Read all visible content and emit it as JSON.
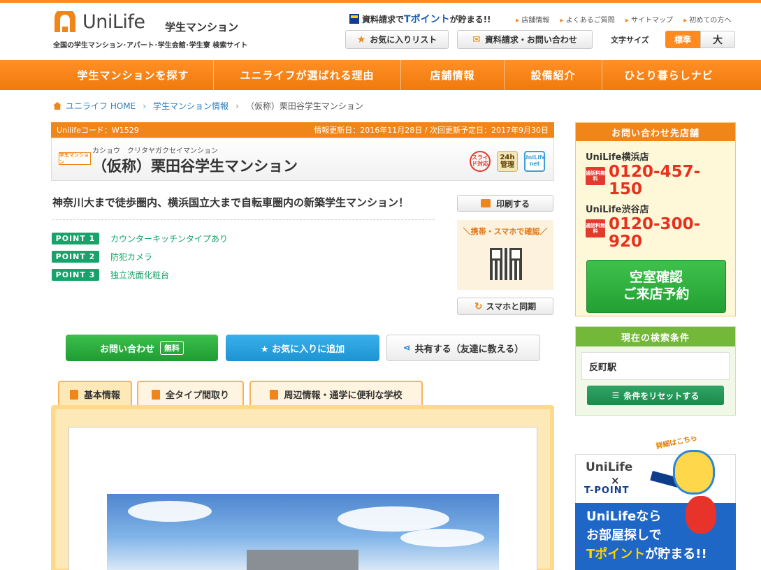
{
  "header": {
    "logo_name": "UniLife",
    "logo_sub": "学生マンション",
    "logo_tag": "全国の学生マンション･アパート･学生会館･学生寮 検索サイト",
    "tpoint_pre": "資料請求で",
    "tpoint_brand": "Tポイント",
    "tpoint_post": "が貯まる!!",
    "top_links": [
      "店舗情報",
      "よくあるご質問",
      "サイトマップ",
      "初めての方へ"
    ],
    "favorites_label": "お気に入りリスト",
    "request_label": "資料請求・お問い合わせ",
    "font_size_label": "文字サイズ",
    "font_std": "標準",
    "font_big": "大"
  },
  "nav": [
    "学生マンションを探す",
    "ユニライフが選ばれる理由",
    "店舗情報",
    "設備紹介",
    "ひとり暮らしナビ"
  ],
  "breadcrumb": {
    "home": "ユニライフ HOME",
    "level2": "学生マンション情報",
    "current": "（仮称）栗田谷学生マンション"
  },
  "property": {
    "code": "Unilifeコード：W1529",
    "updated": "情報更新日：2016年11月28日 / 次回更新予定日：2017年9月30日",
    "type_logo": "学生マンション",
    "kana": "カショウ　クリタヤガクセイマンション",
    "name": "（仮称）栗田谷学生マンション",
    "badges": [
      "スライド対応",
      "24h管理",
      "UniLife net"
    ],
    "catch": "神奈川大まで徒歩圏内、横浜国立大まで自転車圏内の新築学生マンション！",
    "points": [
      {
        "label": "POINT 1",
        "text": "カウンターキッチンタイプあり"
      },
      {
        "label": "POINT 2",
        "text": "防犯カメラ"
      },
      {
        "label": "POINT 3",
        "text": "独立洗面化粧台"
      }
    ],
    "print_label": "印刷する",
    "mobile_label": "＼携帯・スマホで確認／",
    "sync_label": "スマホと同期"
  },
  "actions": {
    "contact": "お問い合わせ",
    "contact_free": "無料",
    "favorite": "★ お気に入りに追加",
    "share": "共有する（友達に教える）"
  },
  "tabs": [
    "基本情報",
    "全タイプ間取り",
    "周辺情報・通学に便利な学校"
  ],
  "sidebar": {
    "contact_title": "お問い合わせ先店舗",
    "free_dial": "通話料無料",
    "shops": [
      {
        "name": "UniLife横浜店",
        "tel": "0120-457-150"
      },
      {
        "name": "UniLife渋谷店",
        "tel": "0120-300-920"
      }
    ],
    "reserve_line1": "空室確認",
    "reserve_line2": "ご来店予約",
    "search_title": "現在の検索条件",
    "search_condition": "反町駅",
    "reset_label": "条件をリセットする"
  },
  "banner": {
    "kuji": "詳細はこちら",
    "logo": "UniLife",
    "x": "×",
    "tpoint": "T-POINT",
    "line1": "UniLifeなら",
    "line2": "お部屋探しで",
    "line3_hl": "Tポイント",
    "line3_rest": "が貯まる!!"
  },
  "colors": {
    "brand_orange": "#f08519",
    "point_green": "#18a36b",
    "tel_red": "#e8301e",
    "fav_blue": "#1f93d2"
  }
}
